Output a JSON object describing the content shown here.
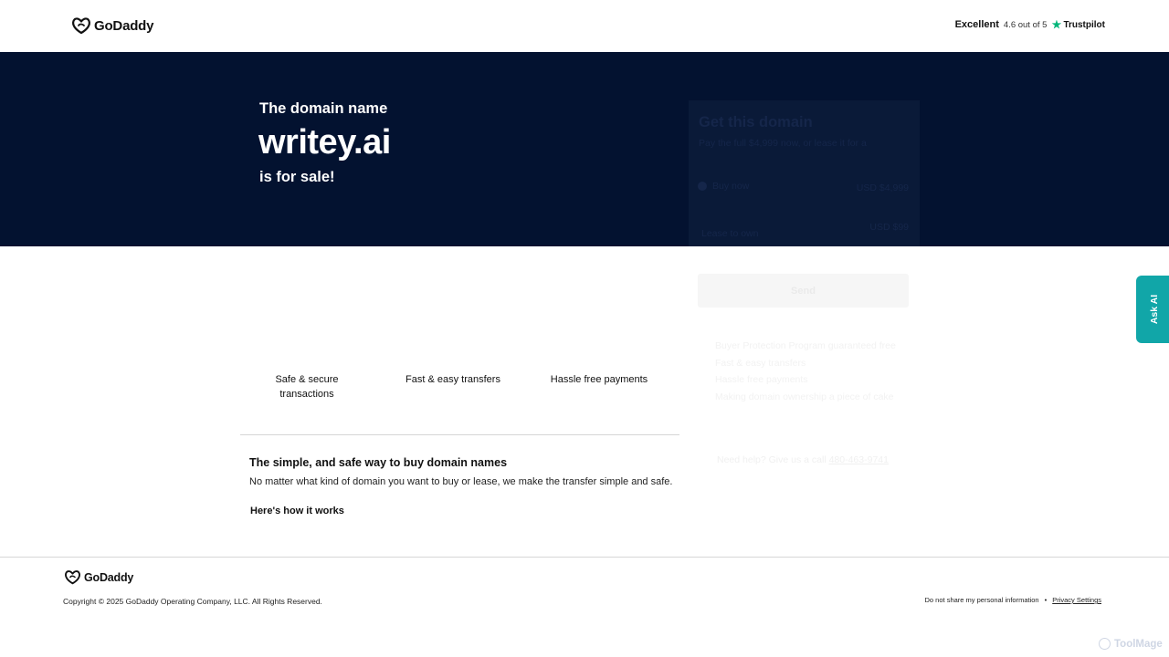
{
  "header": {
    "brand": "GoDaddy",
    "rating_label": "Excellent",
    "rating_score": "4.6 out of 5",
    "rating_source": "Trustpilot"
  },
  "hero": {
    "pre": "The domain name",
    "domain": "writey.ai",
    "post": "is for sale!"
  },
  "offer": {
    "title": "Get this domain",
    "subtitle": "Pay the full $4,999 now, or lease it for a",
    "option_buy": "Buy now",
    "option_buy_price": "USD $4,999",
    "option_lease": "Lease to own",
    "option_lease_price": "USD $99",
    "send_label": "Send",
    "perks": [
      "Buyer Protection Program guaranteed free",
      "Fast & easy transfers",
      "Hassle free payments",
      "Making domain ownership a piece of cake"
    ],
    "help_text": "Need help? Give us a call",
    "help_phone": "480-463-9741"
  },
  "features": [
    "Safe & secure transactions",
    "Fast & easy transfers",
    "Hassle free payments"
  ],
  "info": {
    "title": "The simple, and safe way to buy domain names",
    "text": "No matter what kind of domain you want to buy or lease, we make the transfer simple and safe.",
    "link": "Here's how it works"
  },
  "ask_ai": "Ask AI",
  "footer": {
    "brand": "GoDaddy",
    "copyright": "Copyright © 2025 GoDaddy Operating Company, LLC. All Rights Reserved.",
    "do_not_share": "Do not share my personal information",
    "separator": "•",
    "privacy": "Privacy Settings"
  },
  "watermark": "ToolMage",
  "colors": {
    "hero_bg": "#031230",
    "trustpilot_green": "#00b67a",
    "ask_ai_teal": "#11a6a8"
  }
}
